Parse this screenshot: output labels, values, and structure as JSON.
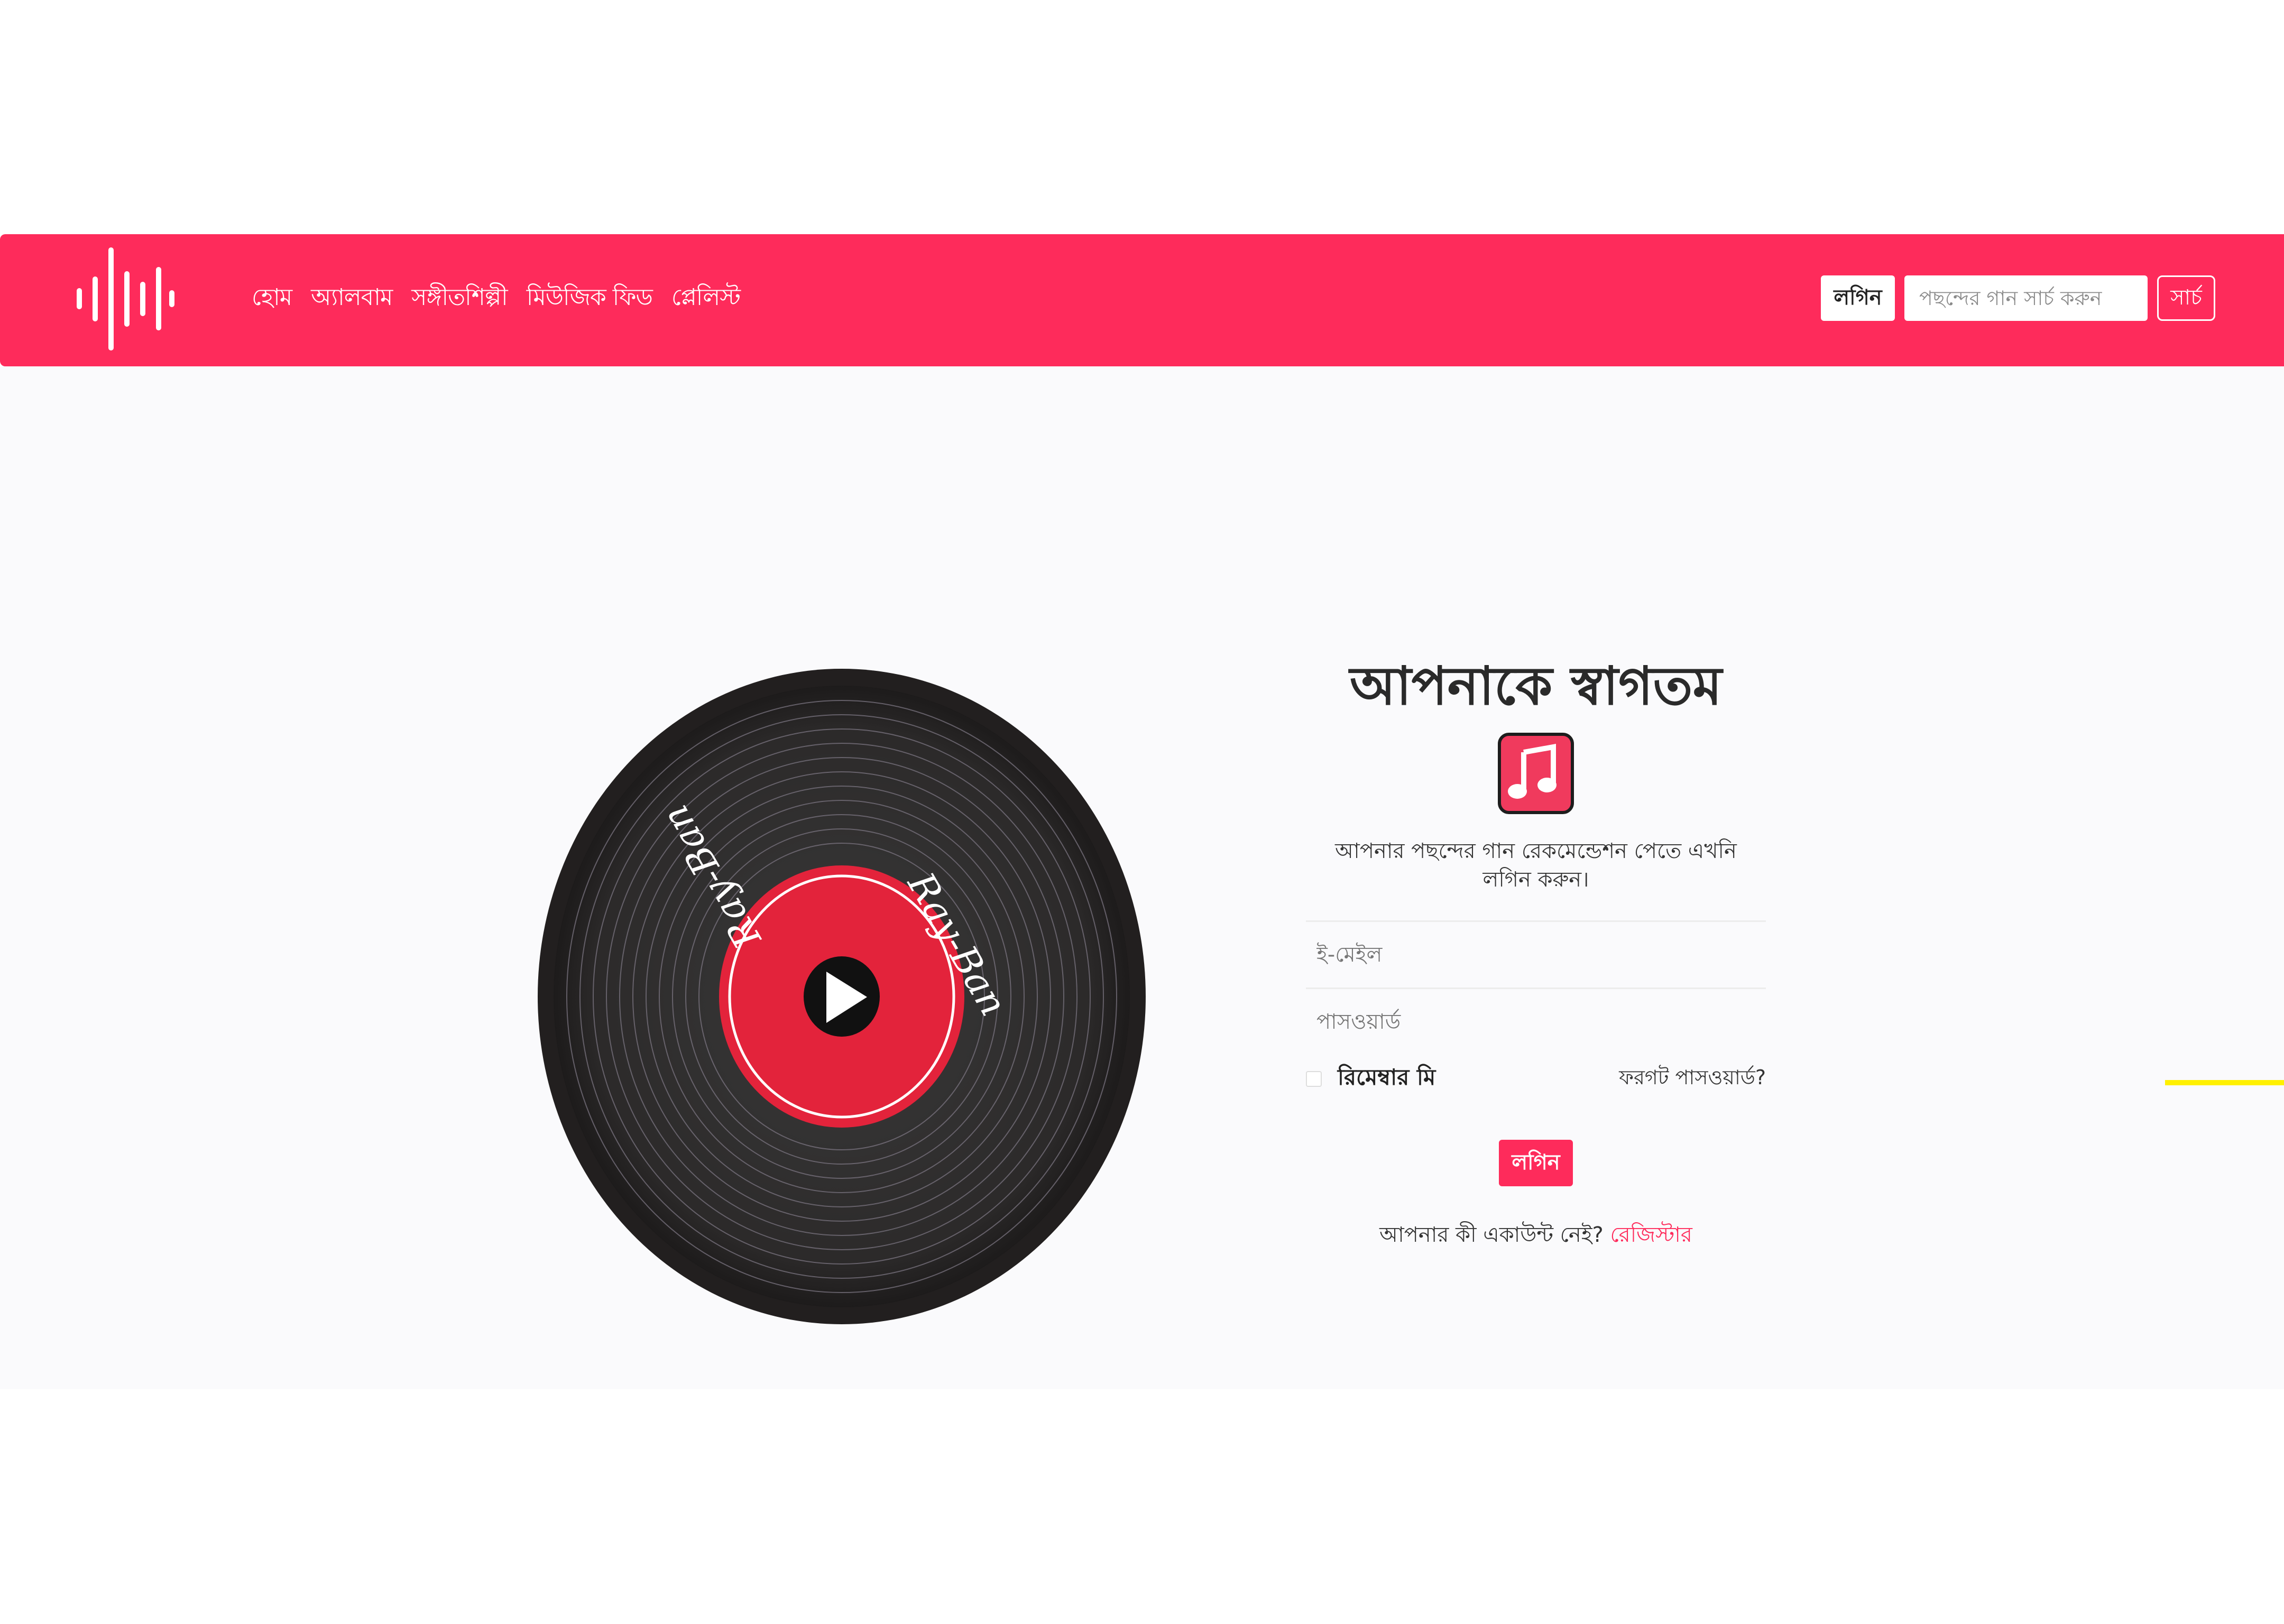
{
  "navbar": {
    "bg_color": "#fe2b5b",
    "logo_icon": "sound-wave-icon",
    "links": [
      {
        "label": "হোম"
      },
      {
        "label": "অ্যালবাম"
      },
      {
        "label": "সঙ্গীতশিল্পী"
      },
      {
        "label": "মিউজিক ফিড"
      },
      {
        "label": "প্লেলিস্ট"
      }
    ],
    "login_label": "লগিন",
    "search_placeholder": "পছন্দের গান সার্চ করুন",
    "search_label": "সার্চ"
  },
  "hero": {
    "record_label_text": "Ray-Ban",
    "record_accent": "#e3233b"
  },
  "login": {
    "title": "আপনাকে স্বাগতম",
    "icon": "music-note-icon",
    "subtitle": "আপনার পছন্দের গান রেকমেন্ডেশন পেতে এখনি লগিন করুন।",
    "email_placeholder": "ই-মেইল",
    "password_placeholder": "পাসওয়ার্ড",
    "remember_label": "রিমেম্বার মি",
    "forgot_label": "ফরগট পাসওয়ার্ড?",
    "submit_label": "লগিন",
    "no_account_text": "আপনার কী একাউন্ট নেই?",
    "register_label": "রেজিস্টার"
  }
}
